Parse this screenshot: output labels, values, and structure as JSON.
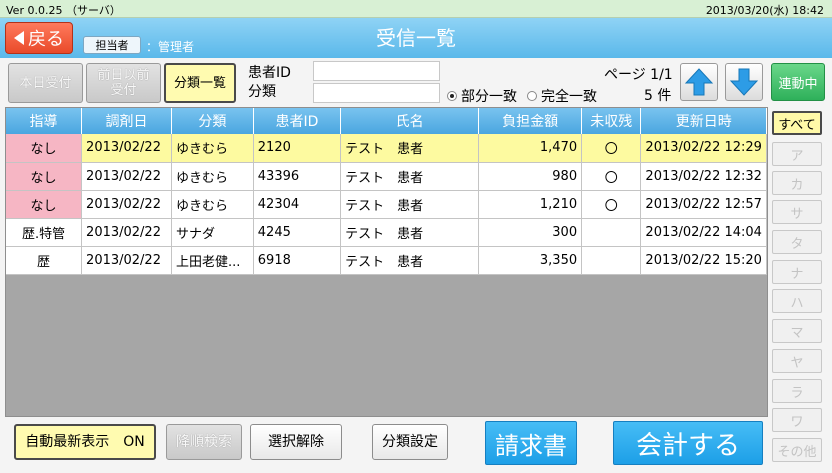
{
  "topbar": {
    "version": "Ver 0.0.25 （サーバ）",
    "datetime": "2013/03/20(水) 18:42"
  },
  "header": {
    "back_label": "戻る",
    "staff_button": "担当者",
    "staff_name": "：管理者",
    "title": "受信一覧"
  },
  "toolbar": {
    "today_label": "本日受付",
    "prev_label_1": "前日以前",
    "prev_label_2": "受付",
    "category_list_label": "分類一覧",
    "patient_id_label": "患者ID",
    "category_label": "分類",
    "patient_id_value": "",
    "category_value": "",
    "partial_match": "部分一致",
    "exact_match": "完全一致",
    "match_selected": "partial",
    "page_info": "ページ 1/1",
    "count_info": "5 件",
    "linked_label": "連動中"
  },
  "table": {
    "columns": [
      "指導",
      "調剤日",
      "分類",
      "患者ID",
      "氏名",
      "負担金額",
      "未収残",
      "更新日時"
    ],
    "rows": [
      {
        "guidance": "なし",
        "date": "2013/02/22",
        "category": "ゆきむら",
        "patient_id": "2120",
        "name": "テスト　患者",
        "amount": "1,470",
        "outstanding": "〇",
        "updated": "2013/02/22 12:29"
      },
      {
        "guidance": "なし",
        "date": "2013/02/22",
        "category": "ゆきむら",
        "patient_id": "43396",
        "name": "テスト　患者",
        "amount": "980",
        "outstanding": "〇",
        "updated": "2013/02/22 12:32"
      },
      {
        "guidance": "なし",
        "date": "2013/02/22",
        "category": "ゆきむら",
        "patient_id": "42304",
        "name": "テスト　患者",
        "amount": "1,210",
        "outstanding": "〇",
        "updated": "2013/02/22 12:57"
      },
      {
        "guidance": "歴.特管",
        "date": "2013/02/22",
        "category": "サナダ",
        "patient_id": "4245",
        "name": "テスト　患者",
        "amount": "300",
        "outstanding": "",
        "updated": "2013/02/22 14:04"
      },
      {
        "guidance": "歴",
        "date": "2013/02/22",
        "category": "上田老健...",
        "patient_id": "6918",
        "name": "テスト　患者",
        "amount": "3,350",
        "outstanding": "",
        "updated": "2013/02/22 15:20"
      }
    ]
  },
  "index_tabs": [
    "すべて",
    "ア",
    "カ",
    "サ",
    "タ",
    "ナ",
    "ハ",
    "マ",
    "ヤ",
    "ラ",
    "ワ",
    "その他"
  ],
  "bottom": {
    "auto_refresh_label": "自動最新表示　ON",
    "desc_search_label": "降順検索",
    "clear_select_label": "選択解除",
    "category_setting_label": "分類設定",
    "invoice_label": "請求書",
    "checkout_label": "会計する"
  },
  "colors": {
    "header": "#5ab8ea",
    "back": "#e94a2a",
    "linked": "#2eb05a",
    "selected_row": "#fdfaa0",
    "guidance_none": "#f6b6c4"
  }
}
